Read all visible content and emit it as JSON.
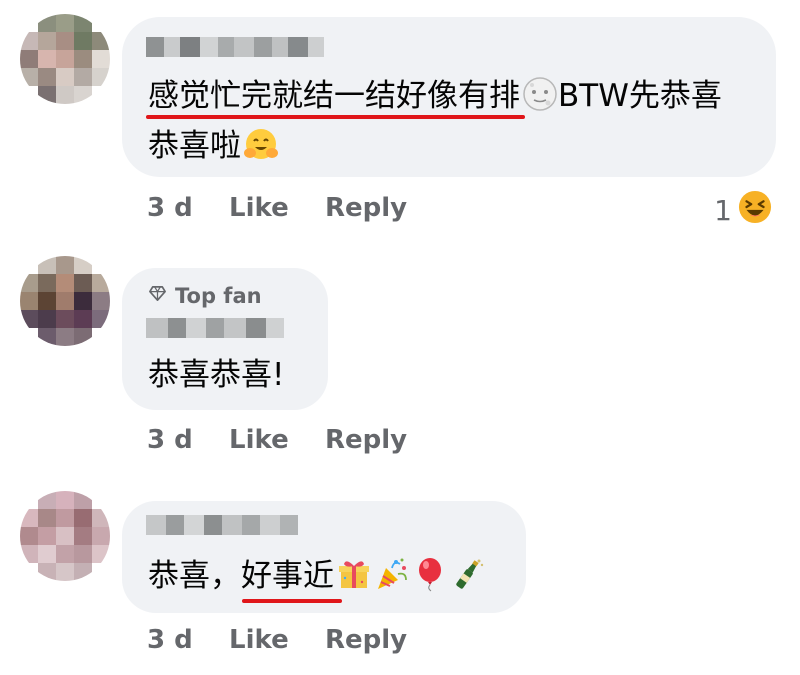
{
  "comments": [
    {
      "text_part1": "感觉忙完就结一结好像有排",
      "text_part2": "BTW先恭喜",
      "text_line2": "恭喜啦",
      "emoji_inline": "moon-face-icon",
      "emoji_end": "hugging-face-icon",
      "time": "3 d",
      "like_label": "Like",
      "reply_label": "Reply",
      "reaction_count": "1",
      "reaction_icon": "laughing-face-icon"
    },
    {
      "badge_label": "Top fan",
      "badge_icon": "diamond-icon",
      "text": "恭喜恭喜!",
      "time": "3 d",
      "like_label": "Like",
      "reply_label": "Reply"
    },
    {
      "text_part1": "恭喜，",
      "text_part2": "好事近",
      "emojis": [
        "wrapped-gift-icon",
        "party-popper-icon",
        "balloon-icon",
        "champagne-icon"
      ],
      "time": "3 d",
      "like_label": "Like",
      "reply_label": "Reply"
    }
  ],
  "colors": {
    "bubble": "#f0f2f5",
    "meta_text": "#65676b",
    "underline": "#e0161a"
  }
}
